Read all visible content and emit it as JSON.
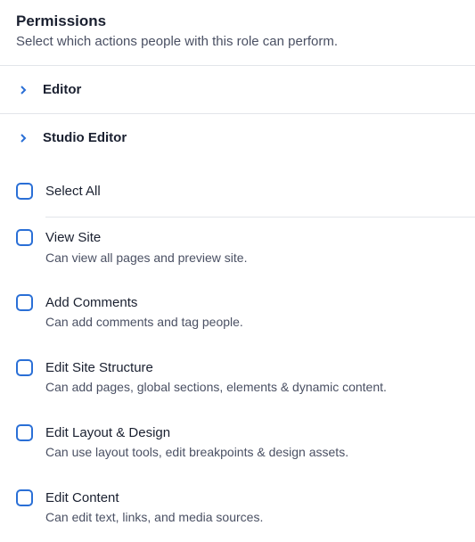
{
  "header": {
    "title": "Permissions",
    "description": "Select which actions people with this role can perform."
  },
  "accordion": {
    "items": [
      {
        "label": "Editor"
      },
      {
        "label": "Studio Editor"
      }
    ]
  },
  "selectAll": {
    "label": "Select All"
  },
  "permissions": [
    {
      "label": "View Site",
      "description": "Can view all pages and preview site."
    },
    {
      "label": "Add Comments",
      "description": "Can add comments and tag people."
    },
    {
      "label": "Edit Site Structure",
      "description": "Can add pages, global sections, elements & dynamic content."
    },
    {
      "label": "Edit Layout & Design",
      "description": "Can use layout tools, edit breakpoints & design assets."
    },
    {
      "label": "Edit Content",
      "description": "Can edit text, links, and media sources."
    }
  ]
}
